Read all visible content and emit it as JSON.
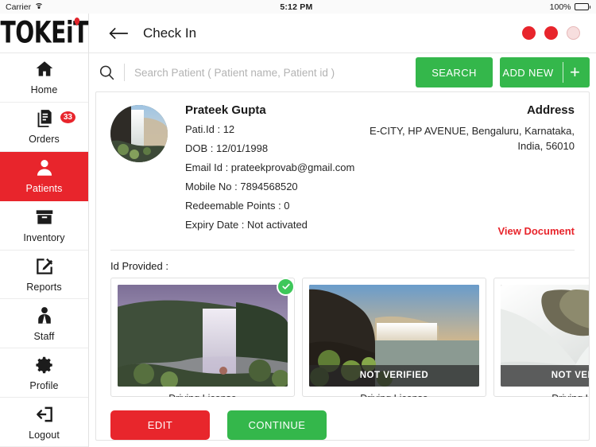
{
  "statusbar": {
    "carrier": "Carrier",
    "time": "5:12 PM",
    "battery": "100%",
    "wifi_icon": "wifi-icon",
    "battery_icon": "battery-full-icon"
  },
  "brand": {
    "logo_text": "TOKEiT"
  },
  "sidebar": {
    "items": [
      {
        "label": "Home",
        "icon": "home-icon",
        "active": false,
        "badge": ""
      },
      {
        "label": "Orders",
        "icon": "documents-icon",
        "active": false,
        "badge": "33"
      },
      {
        "label": "Patients",
        "icon": "person-icon",
        "active": true,
        "badge": ""
      },
      {
        "label": "Inventory",
        "icon": "box-icon",
        "active": false,
        "badge": ""
      },
      {
        "label": "Reports",
        "icon": "edit-square-icon",
        "active": false,
        "badge": ""
      },
      {
        "label": "Staff",
        "icon": "staff-icon",
        "active": false,
        "badge": ""
      },
      {
        "label": "Profile",
        "icon": "gear-icon",
        "active": false,
        "badge": ""
      },
      {
        "label": "Logout",
        "icon": "logout-icon",
        "active": false,
        "badge": ""
      }
    ]
  },
  "topbar": {
    "back_icon": "back-arrow-icon",
    "title": "Check In",
    "dots": [
      "filled",
      "filled",
      "empty"
    ]
  },
  "search": {
    "icon": "search-icon",
    "value": "",
    "placeholder": "Search Patient ( Patient name, Patient id )",
    "search_button": "SEARCH",
    "add_new_button": "ADD NEW",
    "add_new_plus": "+"
  },
  "patient": {
    "avatar_icon": "patient-photo",
    "name": "Prateek Gupta",
    "patient_id": "Pati.Id : 12",
    "dob": "DOB : 12/01/1998",
    "email": "Email Id : prateekprovab@gmail.com",
    "mobile": "Mobile No : 7894568520",
    "points": "Redeemable Points : 0",
    "expiry": "Expiry Date : Not activated",
    "address_title": "Address",
    "address_text": "E-CITY, HP AVENUE, Bengaluru, Karnataka, India, 56010",
    "view_document": "View Document"
  },
  "documents": {
    "section_label": "Id Provided :",
    "items": [
      {
        "label": "Driving License",
        "status": "verified",
        "status_text": "",
        "photo": "waterfall-purple"
      },
      {
        "label": "Driving License",
        "status": "not-verified",
        "status_text": "NOT VERIFIED",
        "photo": "waterfall-golden"
      },
      {
        "label": "Driving License",
        "status": "not-verified",
        "status_text": "NOT VERIFIED",
        "photo": "waterfall-grey"
      }
    ]
  },
  "actions": {
    "edit": "EDIT",
    "continue": "CONTINUE"
  },
  "colors": {
    "brand_red": "#e8252c",
    "green": "#34b74b",
    "check_green": "#3ec75a"
  }
}
